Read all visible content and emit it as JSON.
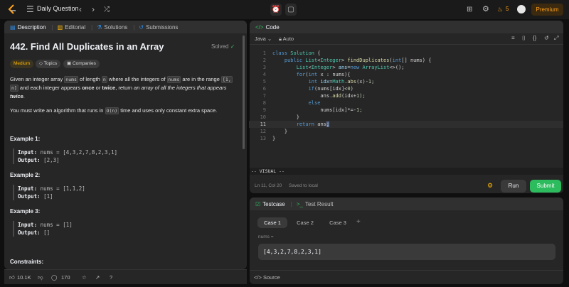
{
  "topbar": {
    "problem_list_label": "Daily Question",
    "streak_count": "5",
    "premium_label": "Premium"
  },
  "desc_panel": {
    "tabs": [
      {
        "label": "Description"
      },
      {
        "label": "Editorial"
      },
      {
        "label": "Solutions"
      },
      {
        "label": "Submissions"
      }
    ],
    "title": "442. Find All Duplicates in an Array",
    "status": "Solved",
    "chips": {
      "difficulty": "Medium",
      "topics": "Topics",
      "companies": "Companies"
    },
    "p1": {
      "a": "Given an integer array ",
      "c1": "nums",
      "b": " of length ",
      "c2": "n",
      "c": " where all the integers of ",
      "c3": "nums",
      "d": " are in the range ",
      "c4": "[1,",
      "c5": "n]",
      "e": " and each integer appears ",
      "once": "once",
      "f": " or ",
      "twice": "twice",
      "g": ", return ",
      "h": "an array of all the integers that appears ",
      "twice2": "twice",
      "i": "."
    },
    "p2": {
      "a": "You must write an algorithm that runs in ",
      "c1": "O(n)",
      "b": " time and uses only constant extra space."
    },
    "examples": [
      {
        "title": "Example 1:",
        "input_label": "Input:",
        "input": "nums = [4,3,2,7,8,2,3,1]",
        "output_label": "Output:",
        "output": "[2,3]"
      },
      {
        "title": "Example 2:",
        "input_label": "Input:",
        "input": "nums = [1,1,2]",
        "output_label": "Output:",
        "output": "[1]"
      },
      {
        "title": "Example 3:",
        "input_label": "Input:",
        "input": "nums = [1]",
        "output_label": "Output:",
        "output": "[]"
      }
    ],
    "constraints_title": "Constraints:"
  },
  "bottombar": {
    "likes": "10.1K",
    "comments": "170"
  },
  "code_panel": {
    "title": "Code",
    "language": "Java",
    "mode": "Auto",
    "lines": [
      {
        "n": "1"
      },
      {
        "n": "2"
      },
      {
        "n": "3"
      },
      {
        "n": "4"
      },
      {
        "n": "5"
      },
      {
        "n": "6"
      },
      {
        "n": "7"
      },
      {
        "n": "8"
      },
      {
        "n": "9"
      },
      {
        "n": "10"
      },
      {
        "n": "11"
      },
      {
        "n": "12"
      },
      {
        "n": "13"
      }
    ],
    "vim_mode": "-- VISUAL --",
    "cursor_pos": "Ln 11, Col 20",
    "save_status": "Saved to local",
    "run_label": "Run",
    "submit_label": "Submit"
  },
  "test_panel": {
    "testcase_tab": "Testcase",
    "result_tab": "Test Result",
    "cases": [
      "Case 1",
      "Case 2",
      "Case 3"
    ],
    "add_symbol": "+",
    "param_label": "nums =",
    "param_value": "[4,3,2,7,8,2,3,1]",
    "source_label": "Source"
  },
  "colors": {
    "accent_green": "#2cbb5d",
    "accent_orange": "#ffa116",
    "medium": "#ffb800"
  }
}
